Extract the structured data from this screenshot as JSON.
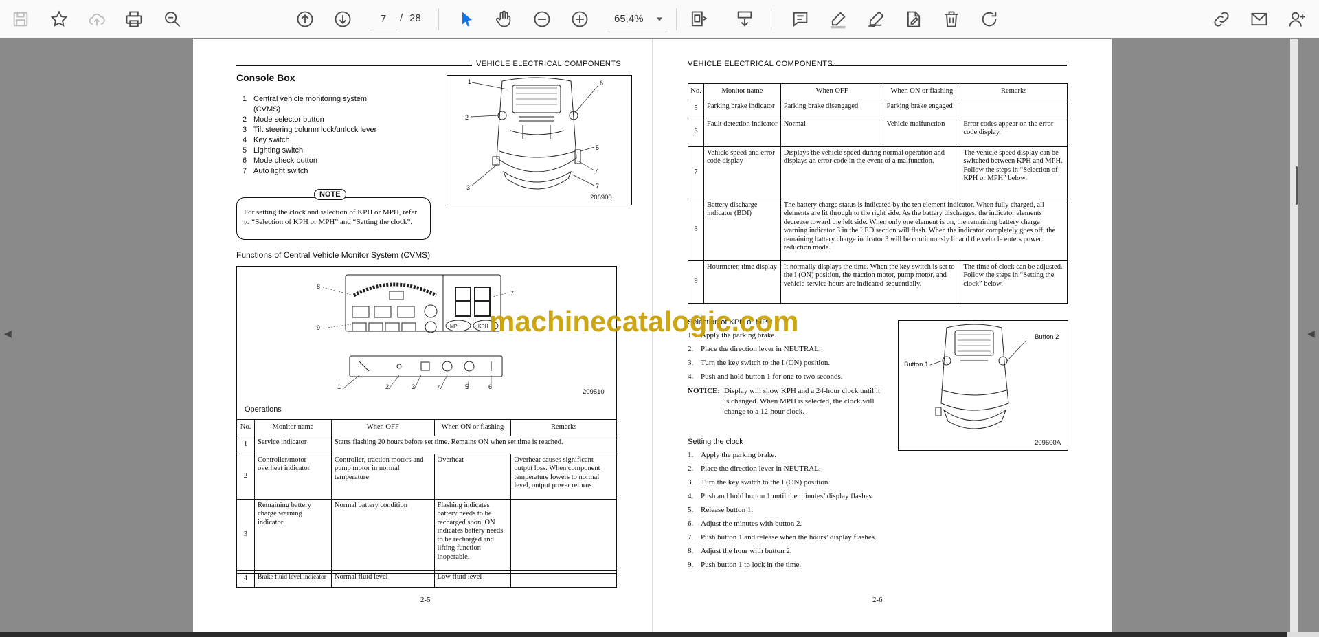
{
  "toolbar": {
    "page_current": "7",
    "page_sep": "/",
    "page_total": "28",
    "zoom": "65,4%"
  },
  "left_page": {
    "header": "VEHICLE ELECTRICAL COMPONENTS",
    "title": "Console Box",
    "items": [
      {
        "n": "1",
        "text": "Central vehicle monitoring system"
      },
      {
        "n": "",
        "text": "(CVMS)"
      },
      {
        "n": "2",
        "text": "Mode selector button"
      },
      {
        "n": "3",
        "text": "Tilt steering column lock/unlock lever"
      },
      {
        "n": "4",
        "text": "Key switch"
      },
      {
        "n": "5",
        "text": "Lighting switch"
      },
      {
        "n": "6",
        "text": "Mode check button"
      },
      {
        "n": "7",
        "text": "Auto light switch"
      }
    ],
    "note_label": "NOTE",
    "note_text": "For setting the clock and selection of KPH or MPH, refer to “Selection of KPH or MPH” and “Setting the clock”.",
    "fig1_no": "206900",
    "fig1_callouts": [
      "1",
      "2",
      "3",
      "4",
      "5",
      "6",
      "7"
    ],
    "cvms_caption": "Functions of Central Vehicle Monitor System (CVMS)",
    "fig2_no": "209510",
    "fig2_callouts": [
      "8",
      "9",
      "7",
      "1",
      "2",
      "3",
      "4",
      "5",
      "6"
    ],
    "fig2_kph": "KPH",
    "fig2_mph": "MPH",
    "ops_caption": "Operations",
    "table_headers": [
      "No.",
      "Monitor name",
      "When OFF",
      "When ON or flashing",
      "Remarks"
    ],
    "rows": [
      {
        "no": "1",
        "name": "Service indicator",
        "merged": "Starts flashing 20 hours before set time.  Remains ON when set time is reached."
      },
      {
        "no": "2",
        "name": "Controller/motor overheat indicator",
        "off": "Controller, traction motors and pump motor in normal temperature",
        "on": "Overheat",
        "remarks": "Overheat causes significant output loss.  When component temperature lowers to normal level, output power returns."
      },
      {
        "no": "3",
        "name": "Remaining battery charge warning indicator",
        "off": "Normal battery condition",
        "on": "Flashing indicates battery needs to be recharged soon. ON indicates battery needs to be recharged and lifting function inoperable.",
        "remarks": ""
      },
      {
        "no": "4",
        "name": "Brake fluid level indicator",
        "off": "Normal fluid level",
        "on": "Low fluid level",
        "remarks": ""
      }
    ],
    "page_no": "2-5"
  },
  "right_page": {
    "header": "VEHICLE ELECTRICAL COMPONENTS",
    "table_headers": [
      "No.",
      "Monitor name",
      "When OFF",
      "When ON or flashing",
      "Remarks"
    ],
    "rows": [
      {
        "no": "5",
        "name": "Parking brake indicator",
        "off": "Parking brake disengaged",
        "on": "Parking brake engaged",
        "remarks": ""
      },
      {
        "no": "6",
        "name": "Fault detection indicator",
        "off": "Normal",
        "on": "Vehicle malfunction",
        "remarks": "Error codes appear on the error code display."
      },
      {
        "no": "7",
        "name": "Vehicle speed and error code display",
        "merged": "Displays the vehicle speed during normal operation and displays an error code in the event of a malfunction.",
        "remarks": "The vehicle speed display can be switched between KPH and MPH.  Follow the steps in “Selection of KPH or MPH” below."
      },
      {
        "no": "8",
        "name": "Battery discharge indicator (BDI)",
        "merged_all": "The battery charge status is indicated by the ten element indicator.  When fully charged, all elements are lit through to the right side.  As the battery discharges, the indicator elements decrease toward the left side.  When only one element is on, the remaining battery charge warning indicator 3 in the LED section will flash.  When the indicator completely goes off, the remaining battery charge indicator 3 will be continuously lit and the vehicle enters power reduction mode."
      },
      {
        "no": "9",
        "name": "Hourmeter, time display",
        "merged": "It normally displays the time. When the key switch is set to the I (ON) position, the traction motor, pump motor, and vehicle service hours are indicated sequentially.",
        "remarks": "The time of clock can be adjusted.  Follow the steps in “Setting the clock” below."
      }
    ],
    "kph_title": "Selection of KPH or MPH",
    "kph_steps": [
      {
        "n": "1.",
        "t": "Apply the parking brake."
      },
      {
        "n": "2.",
        "t": "Place the direction lever in NEUTRAL."
      },
      {
        "n": "3.",
        "t": "Turn the key switch to the I (ON) position."
      },
      {
        "n": "4.",
        "t": "Push and hold button 1 for one to two seconds."
      }
    ],
    "notice_label": "NOTICE:",
    "notice_text": "Display will show KPH and a 24-hour clock until it is changed.  When MPH is selected, the clock will change to a 12-hour clock.",
    "fig3_button1": "Button 1",
    "fig3_button2": "Button 2",
    "fig3_no": "209600A",
    "clock_title": "Setting the clock",
    "clock_steps": [
      {
        "n": "1.",
        "t": "Apply the parking brake."
      },
      {
        "n": "2.",
        "t": "Place the direction lever in NEUTRAL."
      },
      {
        "n": "3.",
        "t": "Turn the key switch to the I (ON) position."
      },
      {
        "n": "4.",
        "t": "Push and hold button 1 until the minutes’ display flashes."
      },
      {
        "n": "5.",
        "t": "Release button 1."
      },
      {
        "n": "6.",
        "t": "Adjust the minutes with button 2."
      },
      {
        "n": "7.",
        "t": "Push button 1 and release when the hours’ display flashes."
      },
      {
        "n": "8.",
        "t": "Adjust the hour with button 2."
      },
      {
        "n": "9.",
        "t": "Push button 1 to lock in the time."
      }
    ],
    "page_no": "2-6"
  },
  "watermark": "machinecatalogic.com"
}
